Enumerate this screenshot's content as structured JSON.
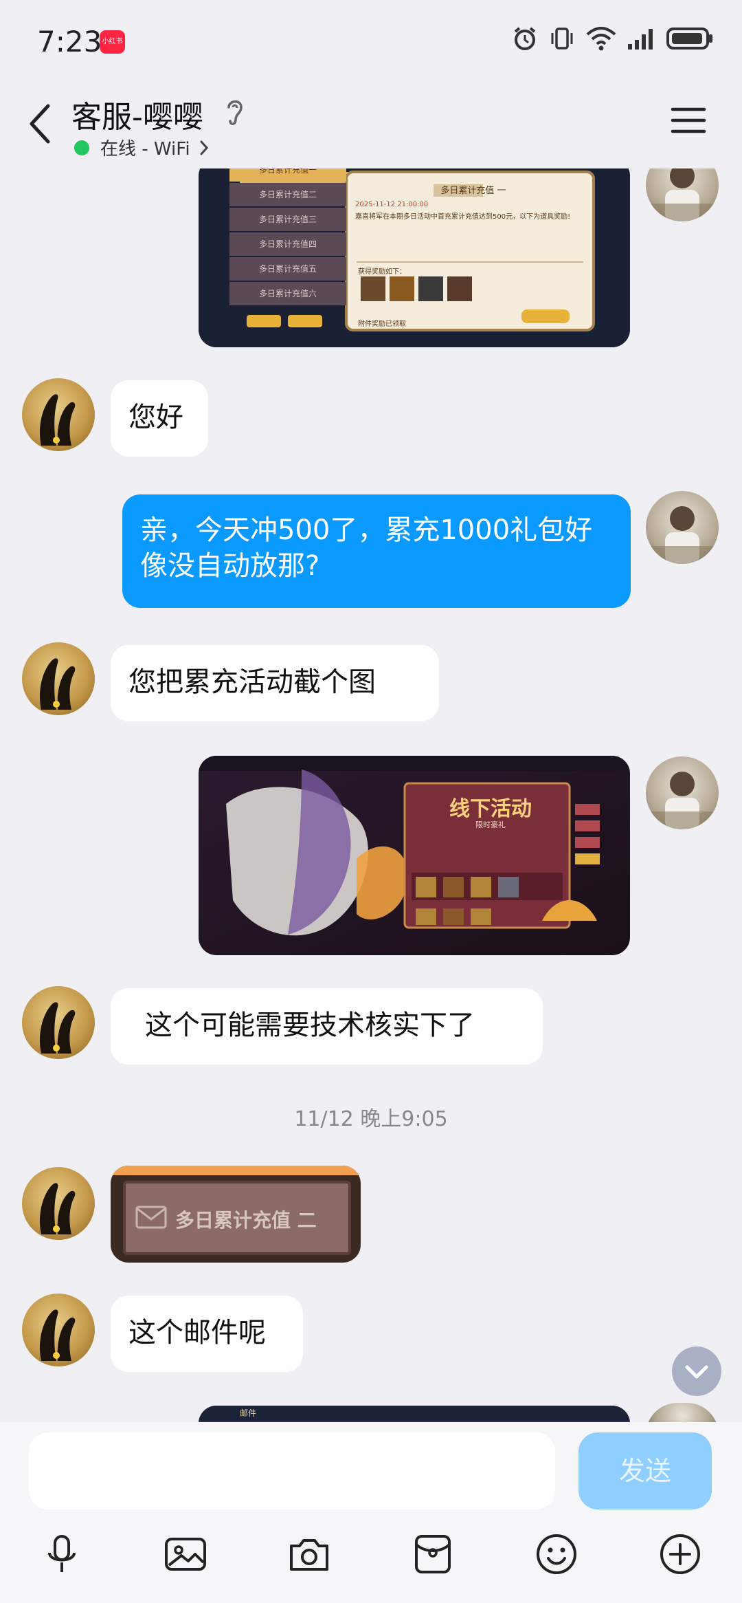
{
  "status_bar": {
    "time": "7:23",
    "app_badge": "小红书"
  },
  "header": {
    "title": "客服-嘤嘤",
    "status": "在线 - WiFi"
  },
  "messages": {
    "m2_text": "您好",
    "m3_text": "亲，今天冲500了，累充1000礼包好像没自动放那?",
    "m4_text": "您把累充活动截个图",
    "m6_text": "这个可能需要技术核实下了",
    "timestamp": "11/12 晚上9:05",
    "m7_card": "多日累计充值 二",
    "m8_text": "这个邮件呢"
  },
  "screenshots": {
    "s1_title": "多日累计充值 一",
    "s1_date": "2025-11-12 21:00:00",
    "s1_desc": "嘉喜将军在本期多日活动中首充累计充值达到500元，以下为道具奖励!",
    "s1_rewards": "获得奖励如下：",
    "s1_footer": "附件奖励已领取",
    "s1_tabs": [
      "多日累计充值一",
      "多日累计充值二",
      "多日累计充值三",
      "多日累计充值四",
      "多日累计充值五",
      "多日累计充值六"
    ],
    "s2_banner": "线下活动",
    "s2_sub": "限时豪礼",
    "s3_label": "邮件"
  },
  "input": {
    "send_label": "发送"
  },
  "colors": {
    "outgoing_bubble": "#0a99ff",
    "online_dot": "#22c55e",
    "send_button": "#8fcfff"
  }
}
